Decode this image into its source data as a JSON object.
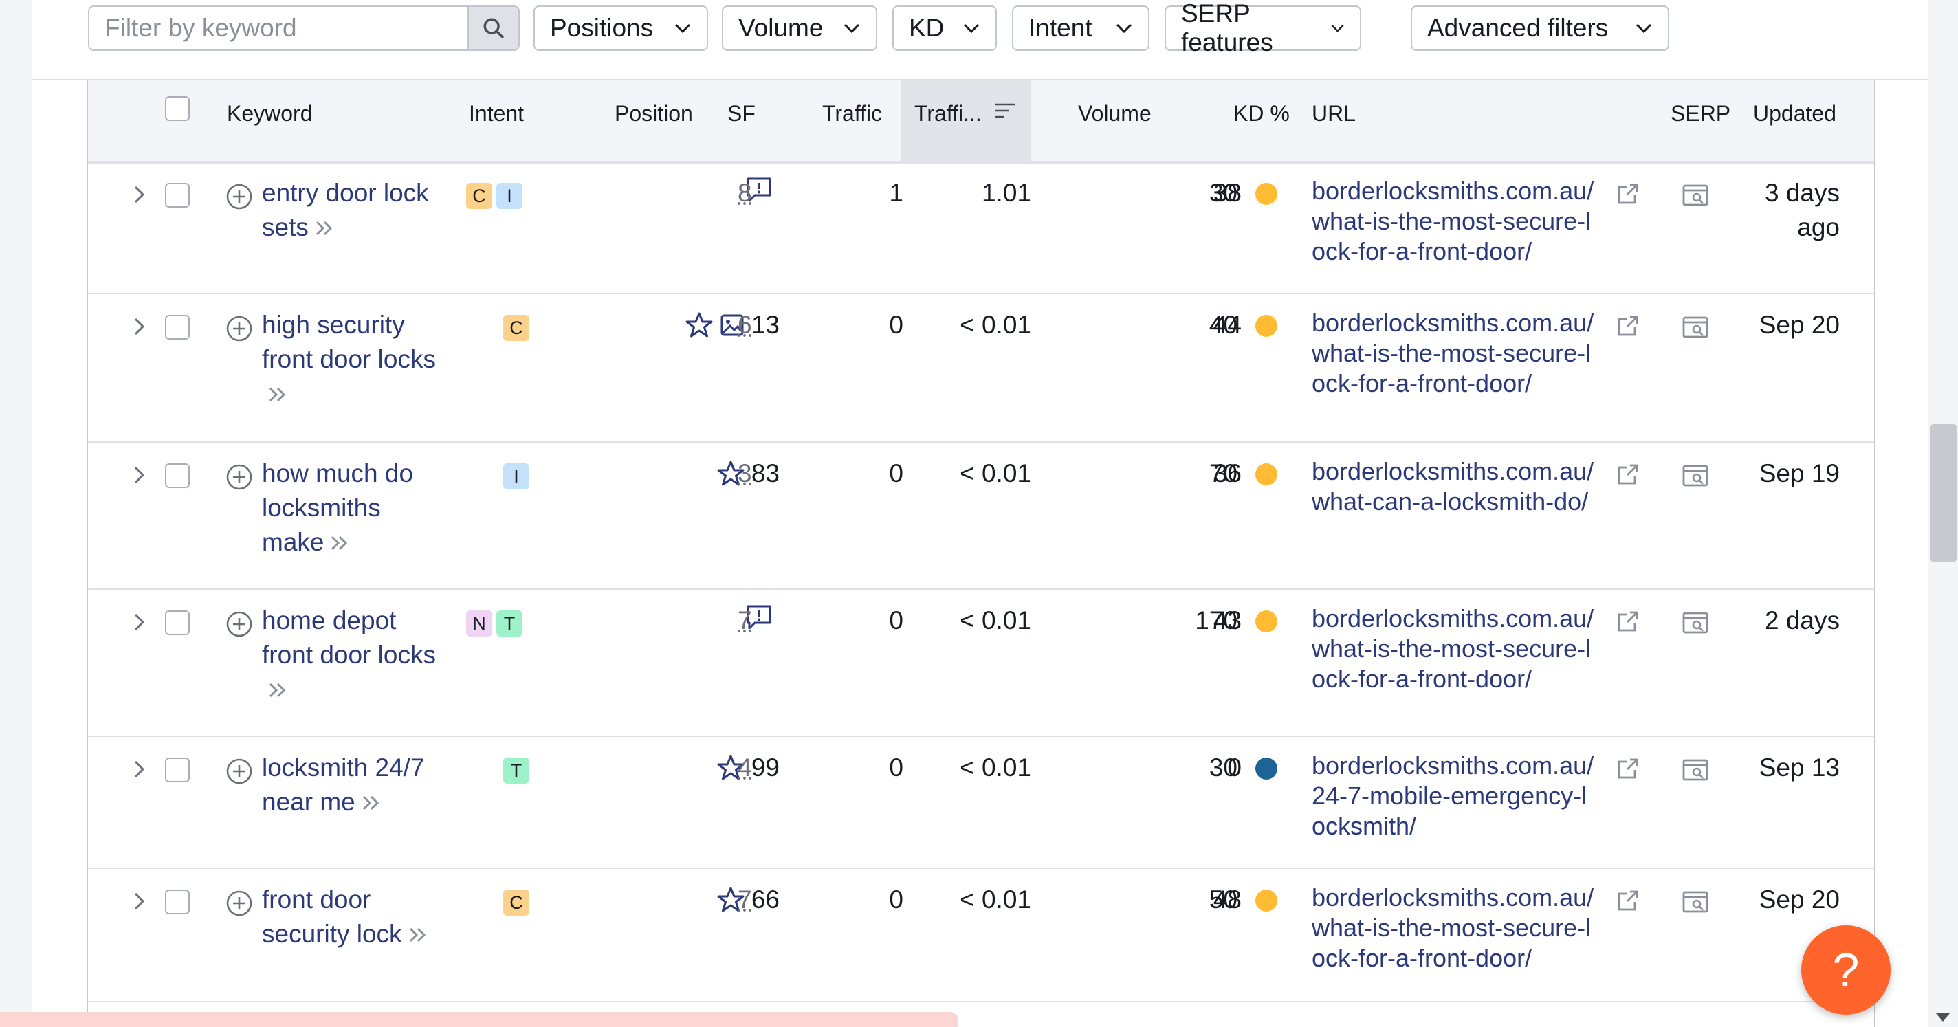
{
  "toolbar": {
    "search_placeholder": "Filter by keyword",
    "filters": [
      "Positions",
      "Volume",
      "KD",
      "Intent",
      "SERP features",
      "Advanced filters"
    ]
  },
  "table": {
    "columns": {
      "keyword": "Keyword",
      "intent": "Intent",
      "position": "Position",
      "sf": "SF",
      "traffic": "Traffic",
      "traffic_pct": "Traffi...",
      "volume": "Volume",
      "kd": "KD %",
      "url": "URL",
      "serp": "SERP",
      "updated": "Updated"
    },
    "rows": [
      {
        "keyword": "entry door lock sets",
        "intents": [
          "C",
          "I"
        ],
        "position_icons": [
          "feedback-icon"
        ],
        "position": "",
        "sf": "8",
        "traffic": "1",
        "traffic_pct": "1.01",
        "volume": "30",
        "kd": "38",
        "kd_color": "#ffbb33",
        "url": "borderlocksmiths.com.au/what-is-the-most-secure-lock-for-a-front-door/",
        "updated": "3 days ago"
      },
      {
        "keyword": "high security front door locks",
        "intents": [
          "C"
        ],
        "position_icons": [
          "star-icon",
          "image-icon"
        ],
        "position": "13",
        "sf": "6",
        "traffic": "0",
        "traffic_pct": "< 0.01",
        "volume": "40",
        "kd": "44",
        "kd_color": "#ffbb33",
        "url": "borderlocksmiths.com.au/what-is-the-most-secure-lock-for-a-front-door/",
        "updated": "Sep 20"
      },
      {
        "keyword": "how much do locksmiths make",
        "intents": [
          "I"
        ],
        "position_icons": [
          "star-icon"
        ],
        "position": "83",
        "sf": "3",
        "traffic": "0",
        "traffic_pct": "< 0.01",
        "volume": "70",
        "kd": "36",
        "kd_color": "#ffbb33",
        "url": "borderlocksmiths.com.au/what-can-a-locksmith-do/",
        "updated": "Sep 19"
      },
      {
        "keyword": "home depot front door locks",
        "intents": [
          "N",
          "T"
        ],
        "position_icons": [
          "feedback-icon"
        ],
        "position": "",
        "sf": "7",
        "traffic": "0",
        "traffic_pct": "< 0.01",
        "volume": "170",
        "kd": "43",
        "kd_color": "#ffbb33",
        "url": "borderlocksmiths.com.au/what-is-the-most-secure-lock-for-a-front-door/",
        "updated": "2 days"
      },
      {
        "keyword": "locksmith 24/7 near me",
        "intents": [
          "T"
        ],
        "position_icons": [
          "star-icon"
        ],
        "position": "99",
        "sf": "4",
        "traffic": "0",
        "traffic_pct": "< 0.01",
        "volume": "30",
        "kd": "0",
        "kd_color": "#1d6396",
        "url": "borderlocksmiths.com.au/24-7-mobile-emergency-locksmith/",
        "updated": "Sep 13"
      },
      {
        "keyword": "front door security lock",
        "intents": [
          "C"
        ],
        "position_icons": [
          "star-icon"
        ],
        "position": "66",
        "sf": "7",
        "traffic": "0",
        "traffic_pct": "< 0.01",
        "volume": "50",
        "kd": "48",
        "kd_color": "#ffbb33",
        "url": "borderlocksmiths.com.au/what-is-the-most-secure-lock-for-a-front-door/",
        "updated": "Sep 20"
      }
    ]
  },
  "help_button": {
    "label": "?"
  }
}
